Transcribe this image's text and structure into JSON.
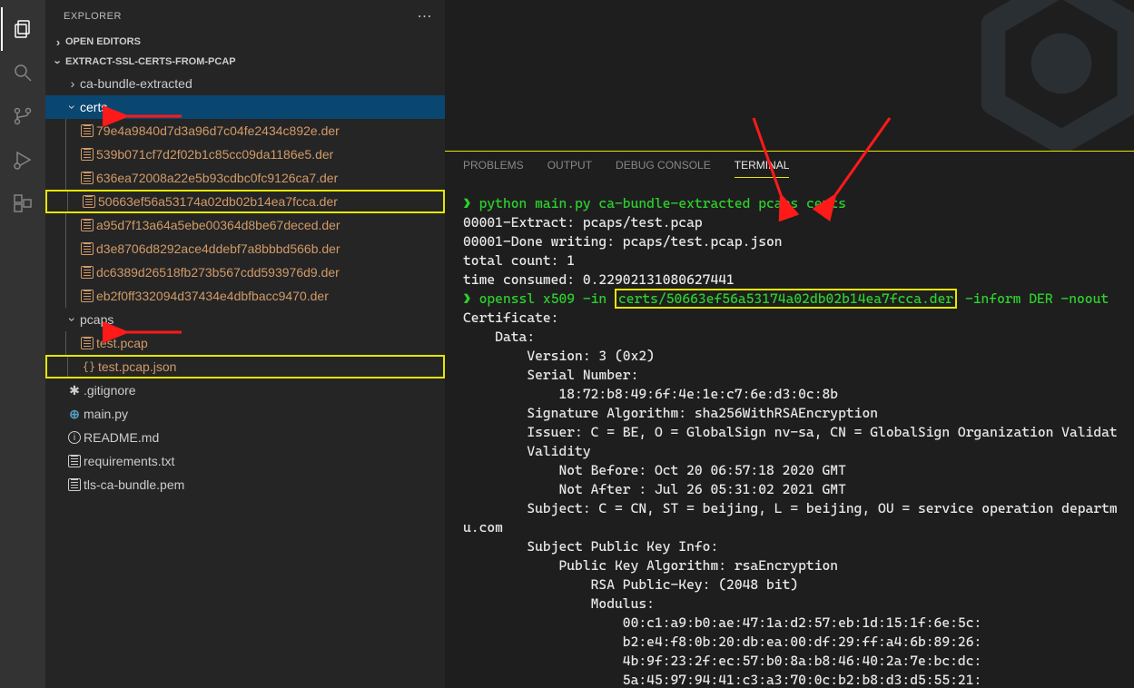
{
  "sidebar": {
    "title": "EXPLORER",
    "sections": {
      "open_editors": "OPEN EDITORS",
      "workspace": "EXTRACT-SSL-CERTS-FROM-PCAP"
    },
    "folders": {
      "ca_bundle": "ca-bundle-extracted",
      "certs": "certs",
      "pcaps": "pcaps"
    },
    "cert_files": [
      "79e4a9840d7d3a96d7c04fe2434c892e.der",
      "539b071cf7d2f02b1c85cc09da1186e5.der",
      "636ea72008a22e5b93cdbc0fc9126ca7.der",
      "50663ef56a53174a02db02b14ea7fcca.der",
      "a95d7f13a64a5ebe00364d8be67deced.der",
      "d3e8706d8292ace4ddebf7a8bbbd566b.der",
      "dc6389d26518fb273b567cdd593976d9.der",
      "eb2f0ff332094d37434e4dbfbacc9470.der"
    ],
    "pcap_files": {
      "test_pcap": "test.pcap",
      "test_json": "test.pcap.json"
    },
    "root_files": {
      "gitignore": ".gitignore",
      "main_py": "main.py",
      "readme": "README.md",
      "requirements": "requirements.txt",
      "bundle": "tls-ca-bundle.pem"
    }
  },
  "panel_tabs": {
    "problems": "PROBLEMS",
    "output": "OUTPUT",
    "debug": "DEBUG CONSOLE",
    "terminal": "TERMINAL"
  },
  "terminal": {
    "line1_cmd": "python main.py ca-bundle-extracted pcaps certs",
    "line2": "00001-Extract: pcaps/test.pcap",
    "line3": "00001-Done writing: pcaps/test.pcap.json",
    "line4": "total count: 1",
    "line5": "time consumed: 0.22902131080627441",
    "line6a": "openssl x509 -in ",
    "line6b": "certs/50663ef56a53174a02db02b14ea7fcca.der",
    "line6c": " -inform DER -noout ",
    "cert": [
      "Certificate:",
      "    Data:",
      "        Version: 3 (0x2)",
      "        Serial Number:",
      "            18:72:b8:49:6f:4e:1e:c7:6e:d3:0c:8b",
      "        Signature Algorithm: sha256WithRSAEncryption",
      "        Issuer: C = BE, O = GlobalSign nv-sa, CN = GlobalSign Organization Validat",
      "        Validity",
      "            Not Before: Oct 20 06:57:18 2020 GMT",
      "            Not After : Jul 26 05:31:02 2021 GMT",
      "        Subject: C = CN, ST = beijing, L = beijing, OU = service operation departm",
      "u.com",
      "        Subject Public Key Info:",
      "            Public Key Algorithm: rsaEncryption",
      "                RSA Public-Key: (2048 bit)",
      "                Modulus:",
      "                    00:c1:a9:b0:ae:47:1a:d2:57:eb:1d:15:1f:6e:5c:",
      "                    b2:e4:f8:0b:20:db:ea:00:df:29:ff:a4:6b:89:26:",
      "                    4b:9f:23:2f:ec:57:b0:8a:b8:46:40:2a:7e:bc:dc:",
      "                    5a:45:97:94:41:c3:a3:70:0c:b2:b8:d3:d5:55:21:"
    ]
  }
}
